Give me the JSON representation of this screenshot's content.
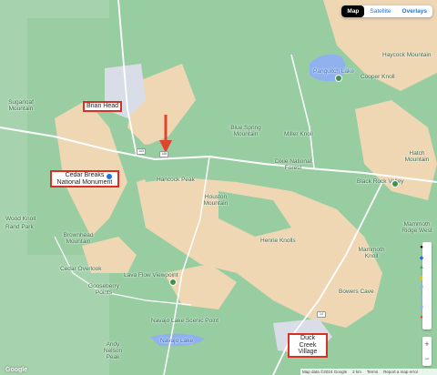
{
  "map_type": {
    "active": "Map",
    "satellite": "Satellite",
    "overlays": "Overlays"
  },
  "highlighted_labels": {
    "brian_head": "Brian Head",
    "cedar_breaks": "Cedar Breaks National Monument",
    "duck_creek": "Duck Creek Village"
  },
  "labels": {
    "panguitch_lake": "Panguitch Lake",
    "haycock": "Haycock Mountain",
    "cooper_knoll": "Cooper Knoll",
    "sugarloaf": "Sugarloaf Mountain",
    "blue_spring": "Blue Spring Mountain",
    "miller_knoll": "Miller Knoll",
    "dixie": "Dixie National Forest",
    "hancock_peak": "Hancock Peak",
    "houston": "Houston Mountain",
    "black_rock": "Black Rock Valley",
    "hatch": "Hatch Mountain",
    "wood_knoll": "Wood Knoll",
    "rand_park": "Rand Park",
    "brownhead": "Brownhead Mountain",
    "henrie_knoll": "Henrie Knolls",
    "mammoth": "Mammoth Ridge West",
    "mammoth_knoll": "Mammoth Knoll",
    "lava_flow": "Lava Flow Viewpoint",
    "gooseberry": "Gooseberry Points",
    "cedar_overlook": "Cedar Overlook",
    "bowers": "Bowers Cave",
    "navajo_scenic": "Navajo Lake Scenic Point",
    "navajo_lake": "Navajo Lake",
    "andy_nelson": "Andy Nelson Peak",
    "pp": "Cowboy Rock"
  },
  "road_shields": [
    "143",
    "148",
    "14"
  ],
  "footer": {
    "data": "Map data ©2024 Google",
    "scale": "2 km",
    "terms": "Terms",
    "report": "Report a map error"
  },
  "brand": "Google",
  "colors": {
    "forest": "#98cda2",
    "terrain": "#efd7b4",
    "lake": "#8fb2ef",
    "urban": "#d9dde8",
    "road": "#ffffff",
    "highlight": "#d93025"
  }
}
